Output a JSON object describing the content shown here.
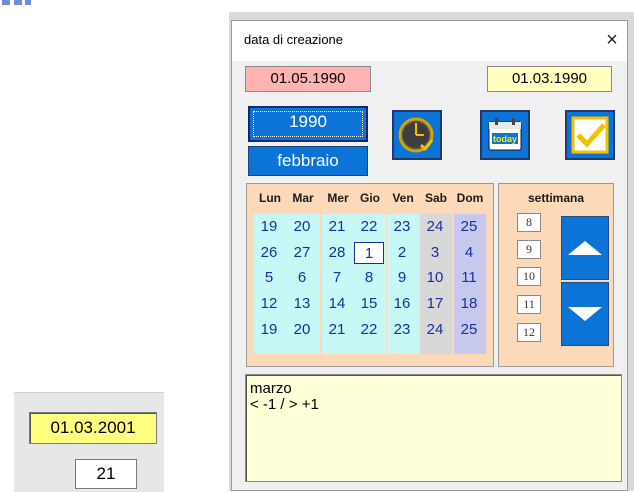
{
  "background": {
    "date_display": "01.03.2001",
    "number_display": "21"
  },
  "dialog": {
    "title": "data di creazione",
    "close_symbol": "×",
    "start_date": "01.05.1990",
    "current_date": "01.03.1990",
    "year_button": "1990",
    "month_button": "febbraio",
    "icons": [
      "clock-icon",
      "today-calendar-icon",
      "checkmark-icon"
    ],
    "today_icon_text": "today"
  },
  "calendar": {
    "days_of_week": [
      "Lun",
      "Mar",
      "Mer",
      "Gio",
      "Ven",
      "Sab",
      "Dom"
    ],
    "weeks": [
      [
        "19",
        "20",
        "21",
        "22",
        "23",
        "24",
        "25"
      ],
      [
        "26",
        "27",
        "28",
        "1",
        "2",
        "3",
        "4"
      ],
      [
        "5",
        "6",
        "7",
        "8",
        "9",
        "10",
        "11"
      ],
      [
        "12",
        "13",
        "14",
        "15",
        "16",
        "17",
        "18"
      ],
      [
        "19",
        "20",
        "21",
        "22",
        "23",
        "24",
        "25"
      ]
    ],
    "selected_day": "1"
  },
  "week_panel": {
    "title": "settimana",
    "weeks": [
      "8",
      "9",
      "10",
      "11",
      "12"
    ],
    "up_icon": "arrow-up-icon",
    "down_icon": "arrow-down-icon"
  },
  "note": {
    "line1": "marzo",
    "line2": "< -1 / > +1"
  },
  "colors": {
    "weekday_bg": "#c8f8f6",
    "saturday_bg": "#d8d8d8",
    "sunday_bg": "#c6c8ee",
    "button_blue": "#0b74d6",
    "calendar_frame": "#fbd9b9"
  }
}
